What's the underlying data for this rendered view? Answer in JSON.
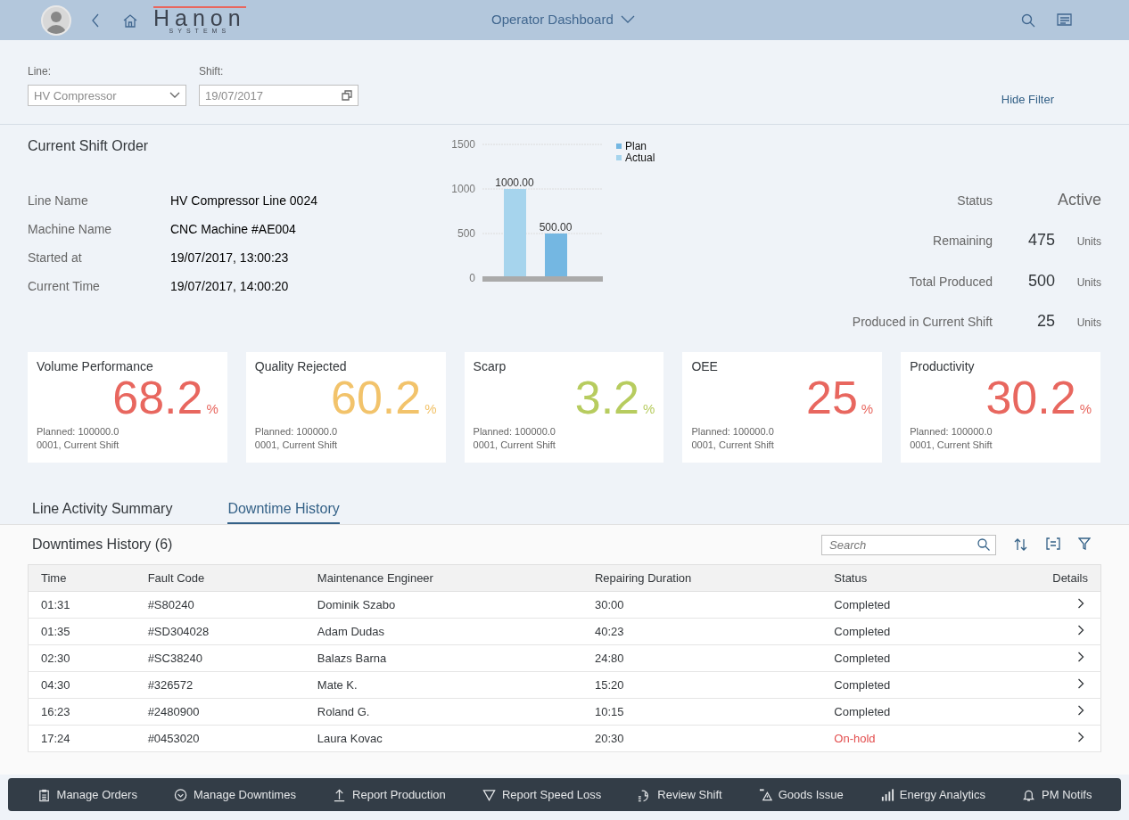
{
  "header": {
    "logo": {
      "name": "Hanon",
      "subtitle": "SYSTEMS"
    },
    "title": "Operator Dashboard"
  },
  "filter": {
    "fields": [
      {
        "label": "Line:",
        "value": "HV Compressor",
        "kind": "select"
      },
      {
        "label": "Shift:",
        "value": "19/07/2017",
        "kind": "date"
      }
    ],
    "hide_link": "Hide Filter"
  },
  "shift_order": {
    "title": "Current Shift Order",
    "details": [
      {
        "label": "Line Name",
        "value": "HV Compressor Line 0024"
      },
      {
        "label": "Machine Name",
        "value": "CNC Machine #AE004"
      },
      {
        "label": "Started at",
        "value": "19/07/2017, 13:00:23"
      },
      {
        "label": "Current Time",
        "value": "19/07/2017, 14:00:20"
      }
    ],
    "chart_data": {
      "type": "bar",
      "ylim": [
        0,
        1500
      ],
      "yticks": [
        0,
        500,
        1000,
        1500
      ],
      "legend": "top-right",
      "series": [
        {
          "name": "Plan",
          "color": "#74b7e2",
          "values": [
            500
          ],
          "value_labels": [
            "500.00"
          ]
        },
        {
          "name": "Actual",
          "color": "#a6d4ed",
          "values": [
            1000
          ],
          "value_labels": [
            "1000.00"
          ]
        }
      ]
    },
    "status": {
      "label": "Status",
      "value": "Active"
    },
    "stats": [
      {
        "label": "Remaining",
        "value": "475",
        "unit": "Units"
      },
      {
        "label": "Total Produced",
        "value": "500",
        "unit": "Units"
      },
      {
        "label": "Produced in Current Shift",
        "value": "25",
        "unit": "Units"
      }
    ]
  },
  "tiles": [
    {
      "title": "Volume Performance",
      "value": "68.2",
      "unit": "%",
      "color": "#e8675f",
      "footer": "Planned: 100000.0\n0001, Current Shift"
    },
    {
      "title": "Quality Rejected",
      "value": "60.2",
      "unit": "%",
      "color": "#f2c36b",
      "footer": "Planned: 100000.0\n0001, Current Shift"
    },
    {
      "title": "Scarp",
      "value": "3.2",
      "unit": "%",
      "color": "#b7cc5f",
      "footer": "Planned: 100000.0\n0001, Current Shift"
    },
    {
      "title": "OEE",
      "value": "25",
      "unit": "%",
      "color": "#e8675f",
      "footer": "Planned: 100000.0\n0001, Current Shift"
    },
    {
      "title": "Productivity",
      "value": "30.2",
      "unit": "%",
      "color": "#e8675f",
      "footer": "Planned: 100000.0\n0001, Current Shift"
    }
  ],
  "tabs": [
    {
      "label": "Line Activity Summary",
      "selected": false
    },
    {
      "label": "Downtime History",
      "selected": true
    }
  ],
  "table": {
    "title": "Downtimes History (6)",
    "search": {
      "placeholder": "Search"
    },
    "columns": [
      "Time",
      "Fault Code",
      "Maintenance Engineer",
      "Repairing Duration",
      "Status",
      "Details"
    ],
    "rows": [
      {
        "cells": [
          "01:31",
          "#S80240",
          "Dominik Szabo",
          "30:00",
          "Completed"
        ],
        "color": "#32363a"
      },
      {
        "cells": [
          "01:35",
          "#SD304028",
          "Adam Dudas",
          "40:23",
          "Completed"
        ],
        "color": "#32363a"
      },
      {
        "cells": [
          "02:30",
          "#SC38240",
          "Balazs Barna",
          "24:80",
          "Completed"
        ],
        "color": "#32363a"
      },
      {
        "cells": [
          "04:30",
          "#326572",
          "Mate K.",
          "15:20",
          "Completed"
        ],
        "color": "#32363a"
      },
      {
        "cells": [
          "16:23",
          "#2480900",
          "Roland G.",
          "10:15",
          "Completed"
        ],
        "color": "#32363a"
      },
      {
        "cells": [
          "17:24",
          "#0453020",
          "Laura Kovac",
          "20:30",
          "On-hold"
        ],
        "color": "#e34f4f"
      }
    ]
  },
  "footer_actions": [
    {
      "label": "Manage Orders",
      "kind": "clipboard"
    },
    {
      "label": "Manage Downtimes",
      "kind": "circle-check"
    },
    {
      "label": "Report Production",
      "kind": "upload"
    },
    {
      "label": "Report Speed Loss",
      "kind": "triangle"
    },
    {
      "label": "Review Shift",
      "kind": "clock"
    },
    {
      "label": "Goods Issue",
      "kind": "warning"
    },
    {
      "label": "Energy Analytics",
      "kind": "bars"
    },
    {
      "label": "PM Notifs",
      "kind": "bell"
    }
  ]
}
